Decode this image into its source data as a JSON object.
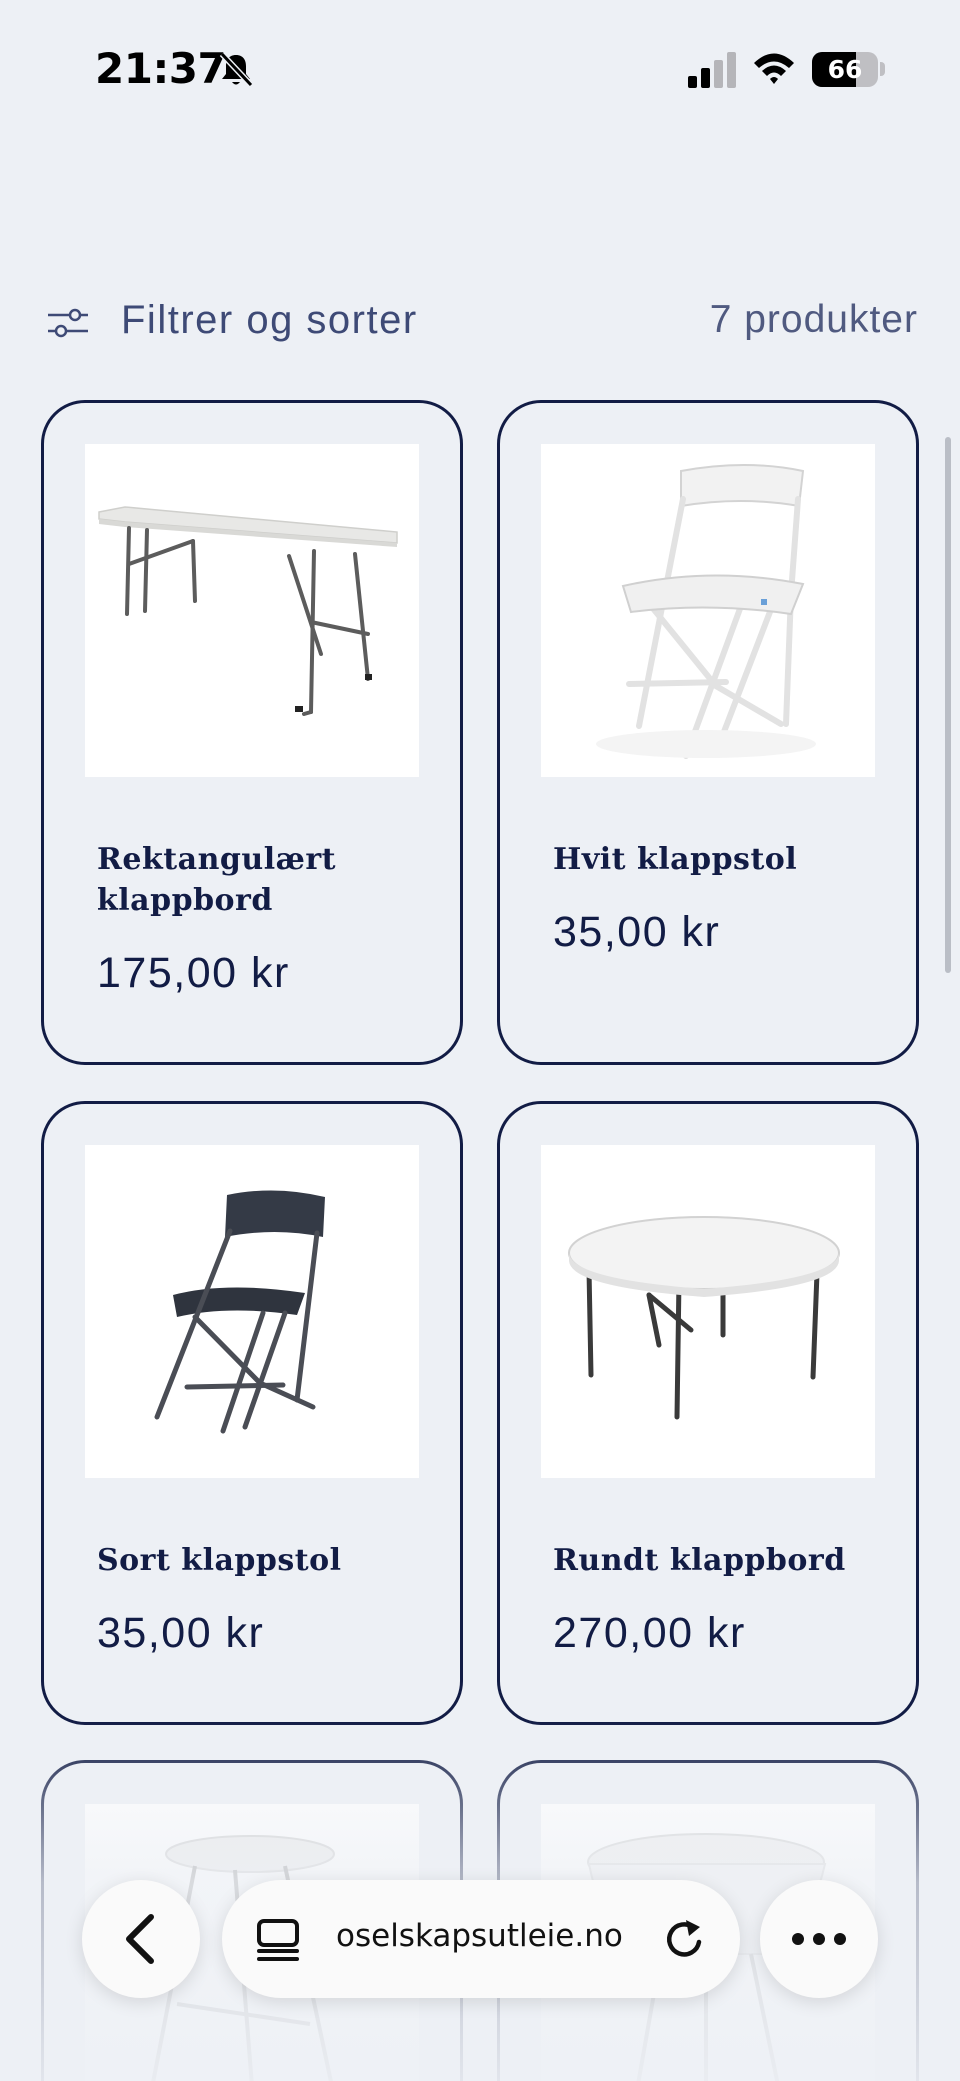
{
  "status_bar": {
    "time": "21:37",
    "battery_level": "66",
    "battery_fraction": 0.66,
    "icons": [
      "bell-slash-icon",
      "cellular-signal-icon",
      "wifi-icon",
      "battery-icon"
    ]
  },
  "filter_bar": {
    "label": "Filtrer og sorter",
    "count": "7 produkter",
    "icon": "sliders-icon"
  },
  "products": [
    {
      "title": "Rektangulært klappbord",
      "price": "175,00 kr",
      "image": "rectangular-folding-table"
    },
    {
      "title": "Hvit klappstol",
      "price": "35,00 kr",
      "image": "white-folding-chair"
    },
    {
      "title": "Sort klappstol",
      "price": "35,00 kr",
      "image": "black-folding-chair"
    },
    {
      "title": "Rundt klappbord",
      "price": "270,00 kr",
      "image": "round-folding-table"
    },
    {
      "title": "",
      "price": "",
      "image": "white-cocktail-table"
    },
    {
      "title": "",
      "price": "",
      "image": "covered-cocktail-table"
    }
  ],
  "browser": {
    "url": "oselskapsutleie.no",
    "icons": [
      "chevron-left-icon",
      "reader-mode-icon",
      "reload-icon",
      "more-icon"
    ]
  },
  "colors": {
    "background": "#edf0f5",
    "navy": "#121c45",
    "muted_text": "#3e4a76"
  }
}
